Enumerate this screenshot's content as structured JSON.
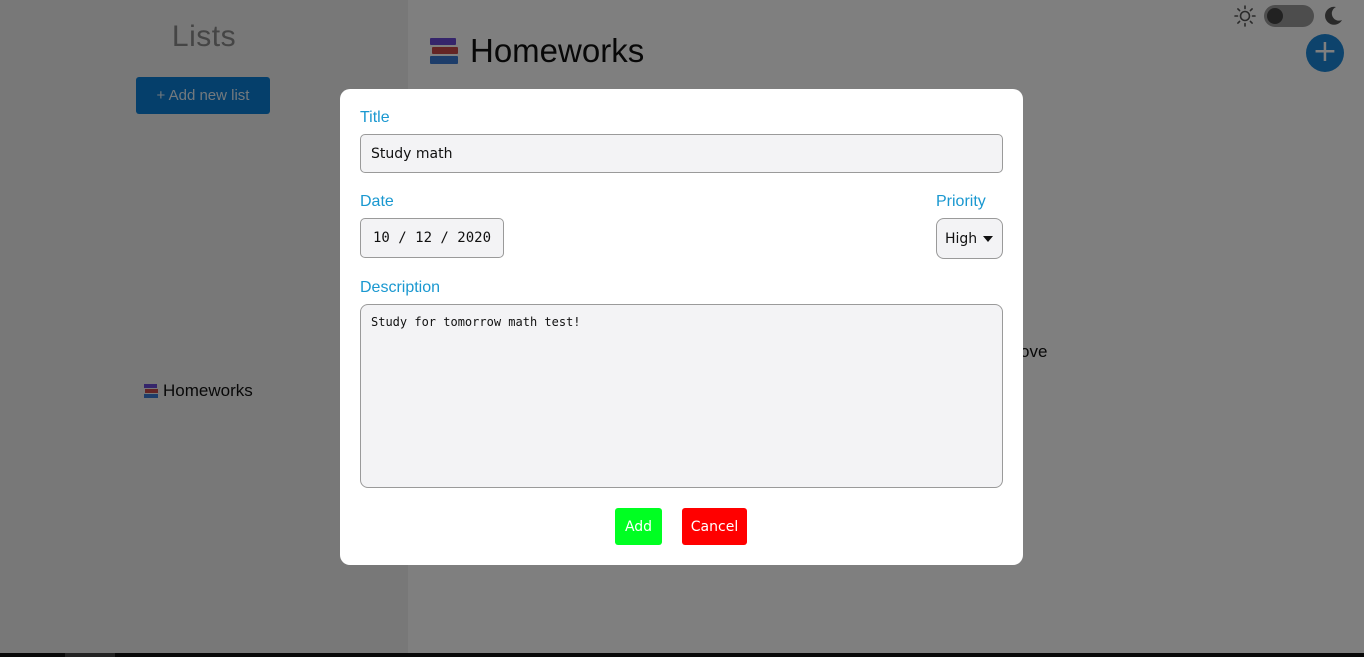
{
  "sidebar": {
    "title": "Lists",
    "add_list_label": "+ Add new list",
    "items": [
      {
        "label": "Homeworks",
        "icon": "books-icon"
      }
    ]
  },
  "main": {
    "title": "Homeworks",
    "title_icon": "books-icon",
    "partial_text": "ove",
    "fab_icon": "+"
  },
  "theme_toggle": {
    "light_icon": "sun-icon",
    "dark_icon": "moon-icon",
    "state": "off"
  },
  "modal": {
    "title_label": "Title",
    "title_value": "Study math",
    "date_label": "Date",
    "date_value": "10 / 12 / 2020",
    "priority_label": "Priority",
    "priority_value": "High",
    "description_label": "Description",
    "description_value": "Study for tomorrow math test!",
    "add_label": "Add",
    "cancel_label": "Cancel"
  },
  "colors": {
    "accent": "#1a98d0",
    "add_button": "#00ff22",
    "cancel_button": "#ff0000",
    "primary_button": "#0a7fd6"
  }
}
